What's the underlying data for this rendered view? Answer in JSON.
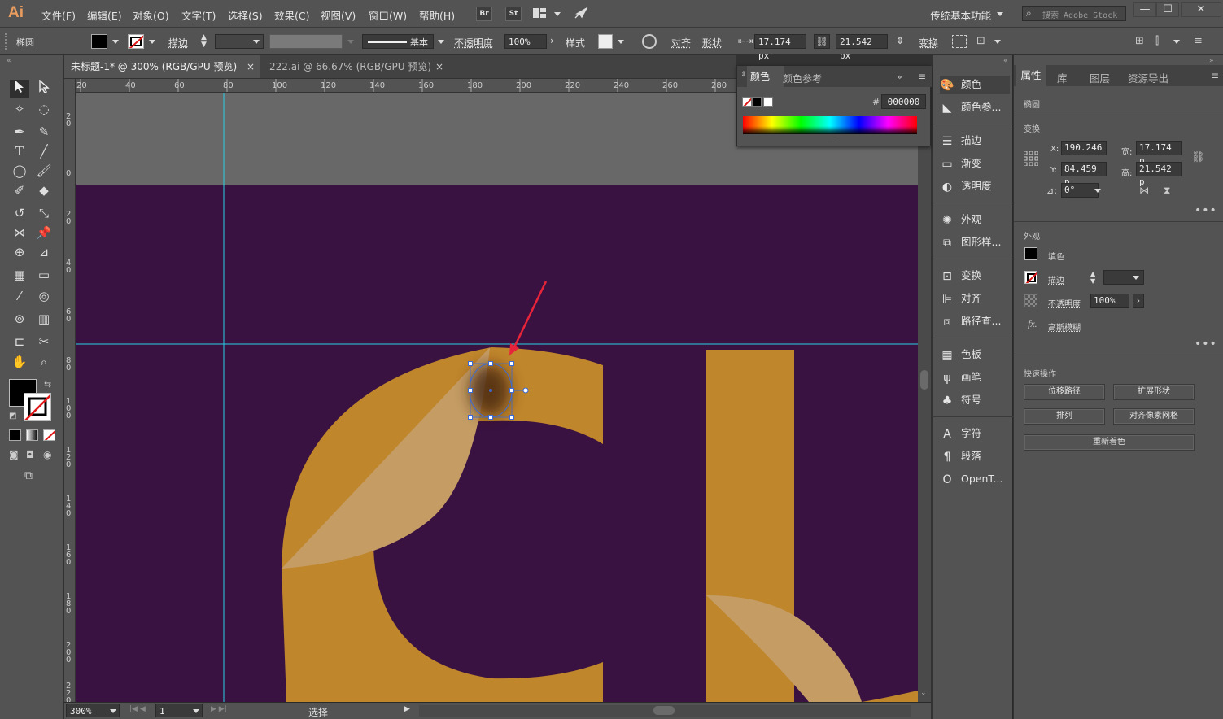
{
  "app": {
    "logo": "Ai",
    "workspace": "传统基本功能",
    "search_placeholder": "搜索 Adobe Stock"
  },
  "menu": [
    "文件(F)",
    "编辑(E)",
    "对象(O)",
    "文字(T)",
    "选择(S)",
    "效果(C)",
    "视图(V)",
    "窗口(W)",
    "帮助(H)"
  ],
  "menubar_buttons": {
    "br": "Br",
    "st": "St"
  },
  "window_controls": {
    "minimize": "—",
    "maximize": "☐",
    "close": "✕"
  },
  "control_bar": {
    "object_type": "椭圆",
    "stroke_label": "描边",
    "brush_label": "基本",
    "opacity_label": "不透明度",
    "opacity_value": "100%",
    "style_label": "样式",
    "align_label": "对齐",
    "shape_label": "形状",
    "width_value": "17.174 px",
    "height_value": "21.542 px",
    "transform_label": "变换"
  },
  "tabs": [
    {
      "title": "未标题-1* @ 300% (RGB/GPU 预览)",
      "close": "×",
      "active": true
    },
    {
      "title": "222.ai @ 66.67% (RGB/GPU 预览)",
      "close": "×",
      "active": false
    }
  ],
  "ruler_h": [
    "20",
    "40",
    "60",
    "80",
    "100",
    "120",
    "140",
    "160",
    "180",
    "200",
    "220",
    "240",
    "260",
    "280"
  ],
  "ruler_v": [
    "2 0",
    "0",
    "2 0",
    "4 0",
    "6 0",
    "8 0",
    "1 0 0",
    "1 2 0",
    "1 4 0",
    "1 6 0",
    "1 8 0",
    "2 0 0",
    "2 2 0"
  ],
  "color_panel": {
    "tab_color": "颜色",
    "tab_guide": "颜色参考",
    "hex_label": "#",
    "hex_value": "000000"
  },
  "icon_panel": {
    "groups": [
      [
        "颜色",
        "颜色参..."
      ],
      [
        "描边",
        "渐变",
        "透明度"
      ],
      [
        "外观",
        "图形样..."
      ],
      [
        "变换",
        "对齐",
        "路径查..."
      ],
      [
        "色板",
        "画笔",
        "符号"
      ],
      [
        "字符",
        "段落",
        "OpenT..."
      ]
    ]
  },
  "properties": {
    "tabs": [
      "属性",
      "库",
      "图层",
      "资源导出"
    ],
    "object_type": "椭圆",
    "transform_title": "变换",
    "x_label": "X:",
    "x_value": "190.246",
    "y_label": "Y:",
    "y_value": "84.459 p",
    "w_label": "宽:",
    "w_value": "17.174 p",
    "h_label": "高:",
    "h_value": "21.542 p",
    "angle_label": "⊿:",
    "angle_value": "0°",
    "appearance_title": "外观",
    "fill_label": "填色",
    "stroke_label": "描边",
    "opacity_label": "不透明度",
    "opacity_value": "100%",
    "effect_label": "高斯模糊",
    "fx": "fx.",
    "quick_title": "快速操作",
    "quick_buttons": [
      "位移路径",
      "扩展形状",
      "排列",
      "对齐像素网格",
      "重新着色"
    ],
    "more": "•••"
  },
  "status": {
    "zoom": "300%",
    "page": "1",
    "tool": "选择"
  },
  "colors": {
    "artboard": "#3a1241",
    "orange": "#c0862c",
    "light": "#c59d64",
    "guide": "#26d0e6",
    "selection": "#3b6bd5",
    "arrow": "#e8243a"
  }
}
